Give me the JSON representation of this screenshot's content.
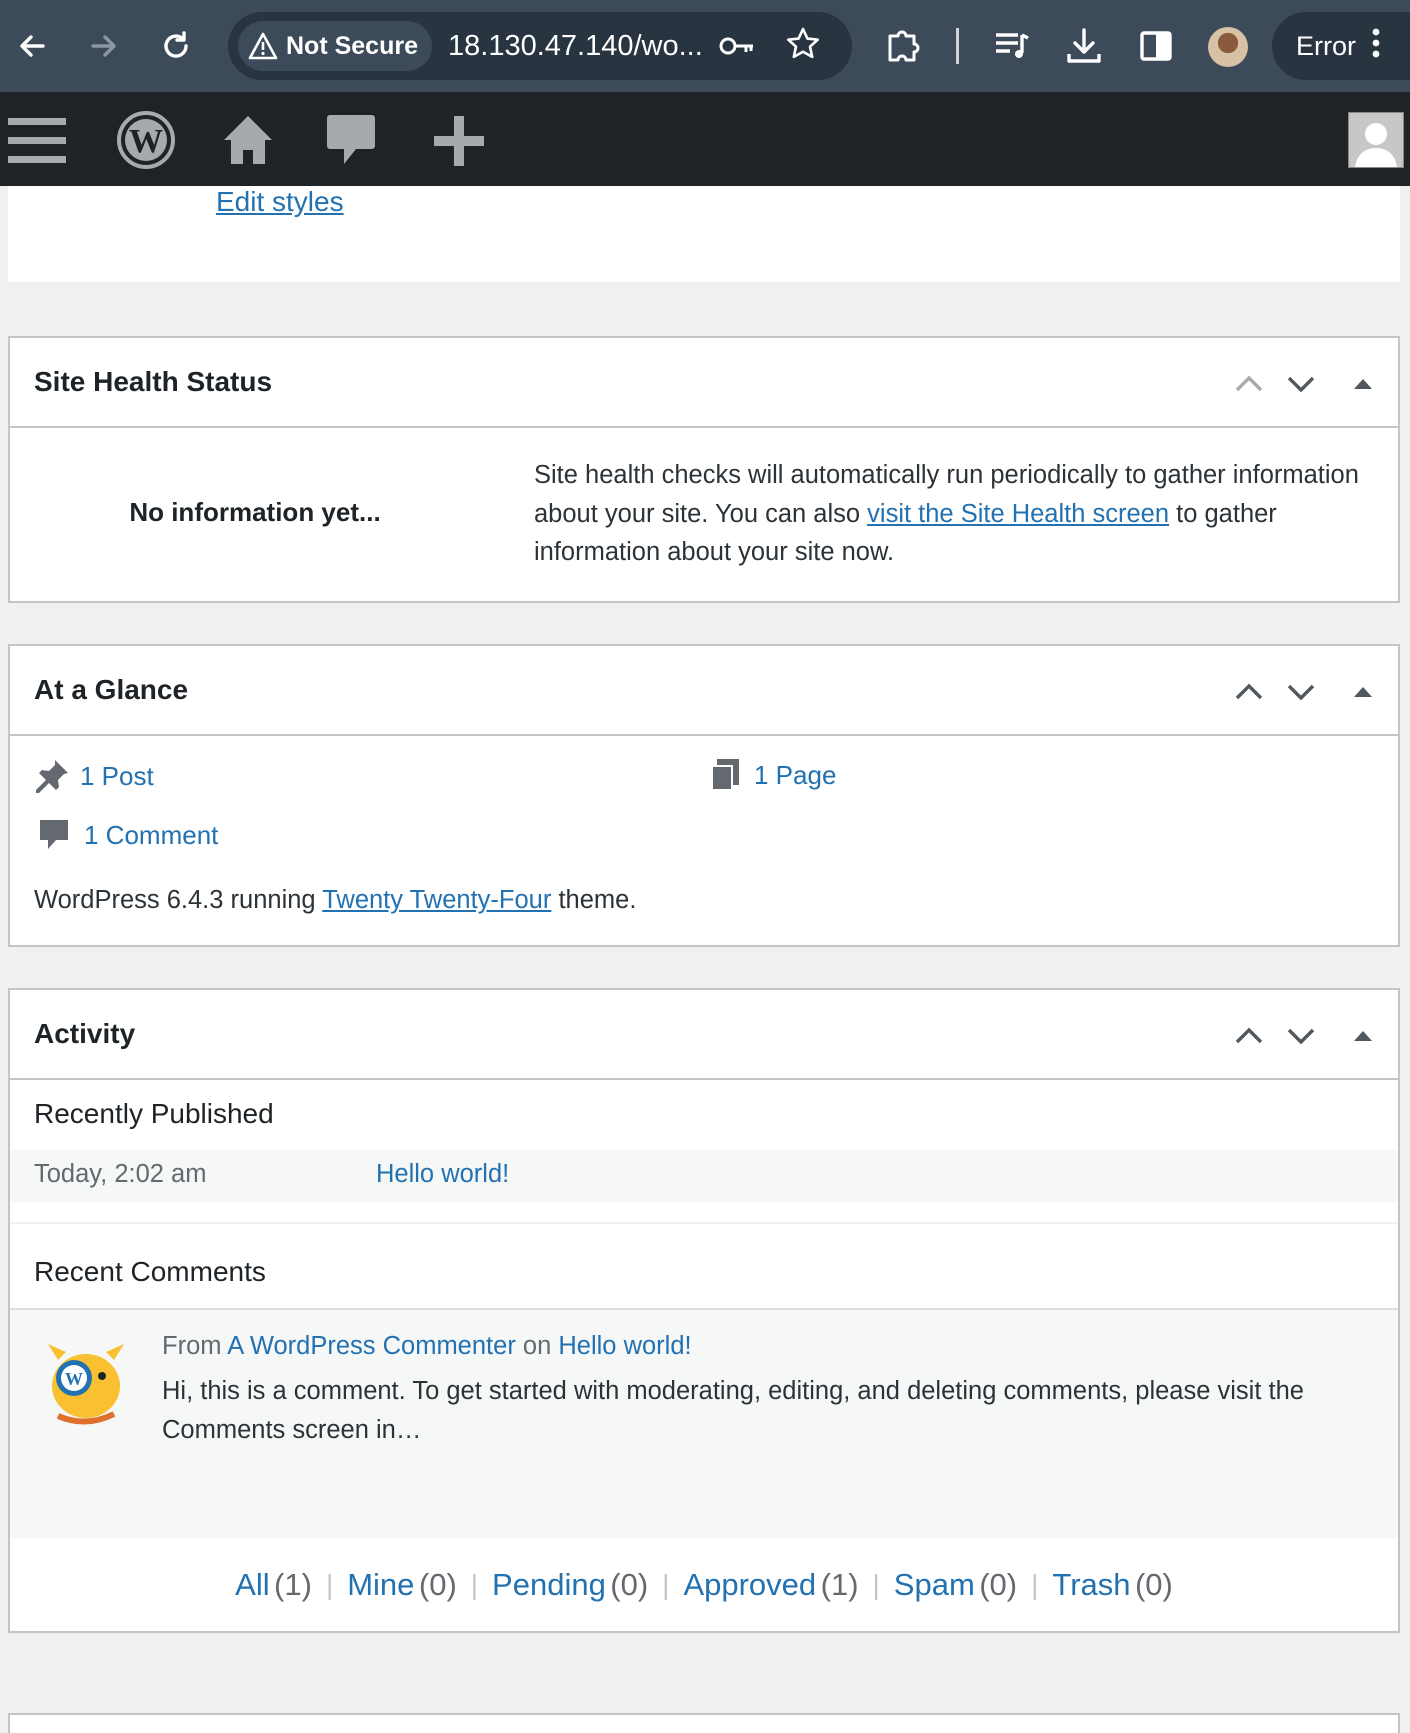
{
  "browser": {
    "security_label": "Not Secure",
    "url": "18.130.47.140/wo...",
    "error_label": "Error"
  },
  "top_card": {
    "edit_styles_link": "Edit styles"
  },
  "site_health": {
    "title": "Site Health Status",
    "no_info": "No information yet...",
    "desc_before": "Site health checks will automatically run periodically to gather information about your site. You can also ",
    "desc_link": "visit the Site Health screen",
    "desc_after": " to gather information about your site now."
  },
  "at_a_glance": {
    "title": "At a Glance",
    "posts": "1 Post",
    "pages": "1 Page",
    "comments": "1 Comment",
    "version_before": "WordPress 6.4.3 running ",
    "theme_link": "Twenty Twenty-Four",
    "version_after": " theme."
  },
  "activity": {
    "title": "Activity",
    "recently_published_heading": "Recently Published",
    "published_items": [
      {
        "date": "Today, 2:02 am",
        "title": "Hello world!"
      }
    ],
    "recent_comments_heading": "Recent Comments",
    "comment": {
      "from_label": "From",
      "author": "A WordPress Commenter",
      "on_label": "on",
      "post": "Hello world!",
      "excerpt": "Hi, this is a comment. To get started with moderating, editing, and deleting comments, please visit the Comments screen in…"
    },
    "filters": [
      {
        "label": "All",
        "count": "(1)"
      },
      {
        "label": "Mine",
        "count": "(0)"
      },
      {
        "label": "Pending",
        "count": "(0)"
      },
      {
        "label": "Approved",
        "count": "(1)"
      },
      {
        "label": "Spam",
        "count": "(0)"
      },
      {
        "label": "Trash",
        "count": "(0)"
      }
    ]
  }
}
